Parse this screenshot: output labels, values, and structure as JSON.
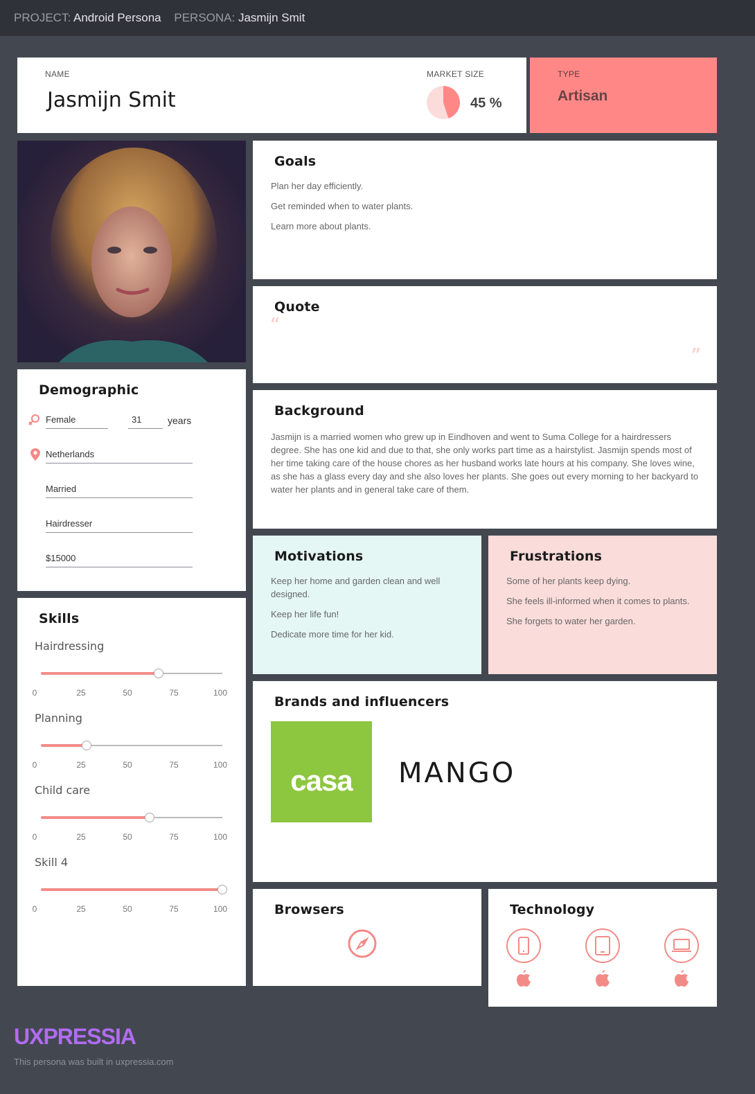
{
  "topbar": {
    "project_label": "PROJECT:",
    "project_value": "Android Persona",
    "persona_label": "PERSONA:",
    "persona_value": "Jasmijn Smit"
  },
  "header": {
    "name_label": "NAME",
    "name": "Jasmijn Smit",
    "market_label": "MARKET SIZE",
    "market_value": "45 %",
    "market_fraction": 0.45,
    "type_label": "TYPE",
    "type_value": "Artisan"
  },
  "goals": {
    "title": "Goals",
    "items": [
      "Plan her day efficiently.",
      "Get reminded when to water plants.",
      "Learn more about plants."
    ]
  },
  "quote": {
    "title": "Quote",
    "open_mark": "“",
    "close_mark": "”"
  },
  "background": {
    "title": "Background",
    "text": "Jasmijn is a married women who grew up in Eindhoven and went to Suma College for a hairdressers degree. She has one kid and due to that, she only works part time as a hairstylist. Jasmijn spends most of her time taking care of the house chores as her husband works late hours at his company. She loves wine, as she has a glass every day and she also loves her plants. She goes out every morning to her backyard to water her plants and in general take care of them."
  },
  "demographic": {
    "title": "Demographic",
    "gender": "Female",
    "age": "31",
    "age_unit": "years",
    "location": "Netherlands",
    "status": "Married",
    "occupation": "Hairdresser",
    "income": "$15000"
  },
  "skills": {
    "title": "Skills",
    "ticks": [
      "0",
      "25",
      "50",
      "75",
      "100"
    ],
    "items": [
      {
        "name": "Hairdressing",
        "value": 65
      },
      {
        "name": "Planning",
        "value": 25
      },
      {
        "name": "Child care",
        "value": 60
      },
      {
        "name": "Skill 4",
        "value": 100
      }
    ]
  },
  "motivations": {
    "title": "Motivations",
    "items": [
      "Keep her home and garden clean and well designed.",
      "Keep her life fun!",
      "Dedicate more time for her kid."
    ]
  },
  "frustrations": {
    "title": "Frustrations",
    "items": [
      "Some of her plants keep dying.",
      "She feels ill-informed when it comes to plants.",
      "She forgets to water her garden."
    ]
  },
  "brands": {
    "title": "Brands and influencers",
    "logos": [
      {
        "text": "casa",
        "icon": "casa-logo",
        "color": "#8dc63f"
      },
      {
        "text": "MANGO",
        "icon": "mango-logo",
        "color": "#1a1a1a"
      }
    ]
  },
  "browsers": {
    "title": "Browsers",
    "icon": "safari-icon"
  },
  "technology": {
    "title": "Technology",
    "devices": [
      {
        "icon": "phone-icon",
        "os": "apple-icon"
      },
      {
        "icon": "tablet-icon",
        "os": "apple-icon"
      },
      {
        "icon": "laptop-icon",
        "os": "apple-icon"
      }
    ]
  },
  "footer": {
    "brand": "UXPRESSIA",
    "note": "This persona was built in uxpressia.com"
  },
  "colors": {
    "accent": "#ff8887",
    "motivation_bg": "#e4f7f4",
    "frustration_bg": "#fadcda",
    "brand_purple": "#b06cf2"
  }
}
